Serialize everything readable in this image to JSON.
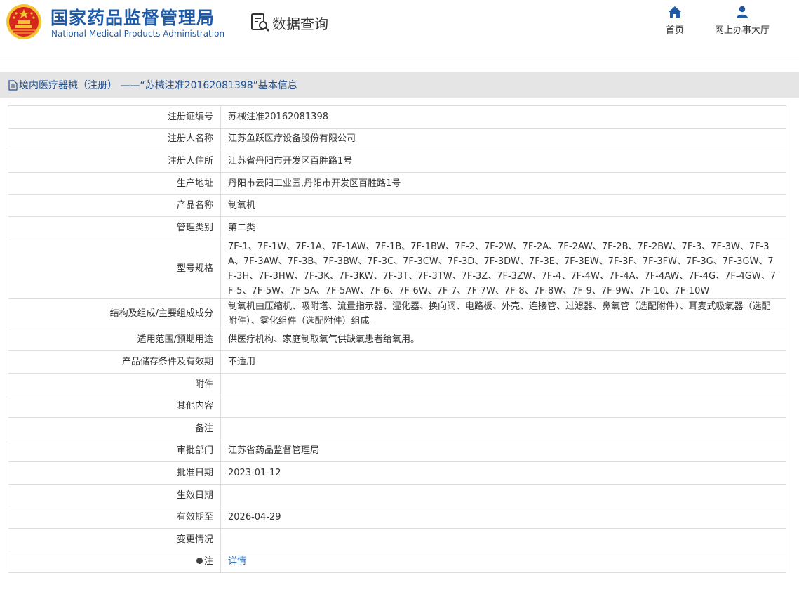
{
  "header": {
    "brand_cn": "国家药品监督管理局",
    "brand_en": "National Medical Products Administration",
    "query_label": "数据查询",
    "nav": [
      {
        "label": "首页",
        "icon": "home-icon"
      },
      {
        "label": "网上办事大厅",
        "icon": "user-icon"
      }
    ],
    "colors": {
      "brand": "#1f5aa6",
      "emblem_red": "#d7261e",
      "emblem_gold": "#f4c430"
    }
  },
  "titlebar": {
    "text": "境内医疗器械（注册） ——“苏械注准20162081398”基本信息",
    "icon": "document-icon"
  },
  "rows": [
    {
      "label": "注册证编号",
      "value": "苏械注准20162081398"
    },
    {
      "label": "注册人名称",
      "value": "江苏鱼跃医疗设备股份有限公司"
    },
    {
      "label": "注册人住所",
      "value": "江苏省丹阳市开发区百胜路1号"
    },
    {
      "label": "生产地址",
      "value": "丹阳市云阳工业园,丹阳市开发区百胜路1号"
    },
    {
      "label": "产品名称",
      "value": "制氧机"
    },
    {
      "label": "管理类别",
      "value": "第二类"
    },
    {
      "label": "型号规格",
      "value": "7F-1、7F-1W、7F-1A、7F-1AW、7F-1B、7F-1BW、7F-2、7F-2W、7F-2A、7F-2AW、7F-2B、7F-2BW、7F-3、7F-3W、7F-3A、7F-3AW、7F-3B、7F-3BW、7F-3C、7F-3CW、7F-3D、7F-3DW、7F-3E、7F-3EW、7F-3F、7F-3FW、7F-3G、7F-3GW、7F-3H、7F-3HW、7F-3K、7F-3KW、7F-3T、7F-3TW、7F-3Z、7F-3ZW、7F-4、7F-4W、7F-4A、7F-4AW、7F-4G、7F-4GW、7F-5、7F-5W、7F-5A、7F-5AW、7F-6、7F-6W、7F-7、7F-7W、7F-8、7F-8W、7F-9、7F-9W、7F-10、7F-10W"
    },
    {
      "label": "结构及组成/主要组成成分",
      "value": "制氧机由压缩机、吸附塔、流量指示器、湿化器、换向阀、电路板、外壳、连接管、过滤器、鼻氧管（选配附件）、耳麦式吸氧器（选配附件）、雾化组件（选配附件）组成。"
    },
    {
      "label": "适用范围/预期用途",
      "value": "供医疗机构、家庭制取氧气供缺氧患者给氧用。"
    },
    {
      "label": "产品储存条件及有效期",
      "value": "不适用"
    },
    {
      "label": "附件",
      "value": ""
    },
    {
      "label": "其他内容",
      "value": ""
    },
    {
      "label": "备注",
      "value": ""
    },
    {
      "label": "审批部门",
      "value": "江苏省药品监督管理局"
    },
    {
      "label": "批准日期",
      "value": "2023-01-12"
    },
    {
      "label": "生效日期",
      "value": ""
    },
    {
      "label": "有效期至",
      "value": "2026-04-29"
    },
    {
      "label": "变更情况",
      "value": ""
    }
  ],
  "note_row": {
    "label": "注",
    "link": "详情",
    "icon": "note-dot-icon"
  }
}
